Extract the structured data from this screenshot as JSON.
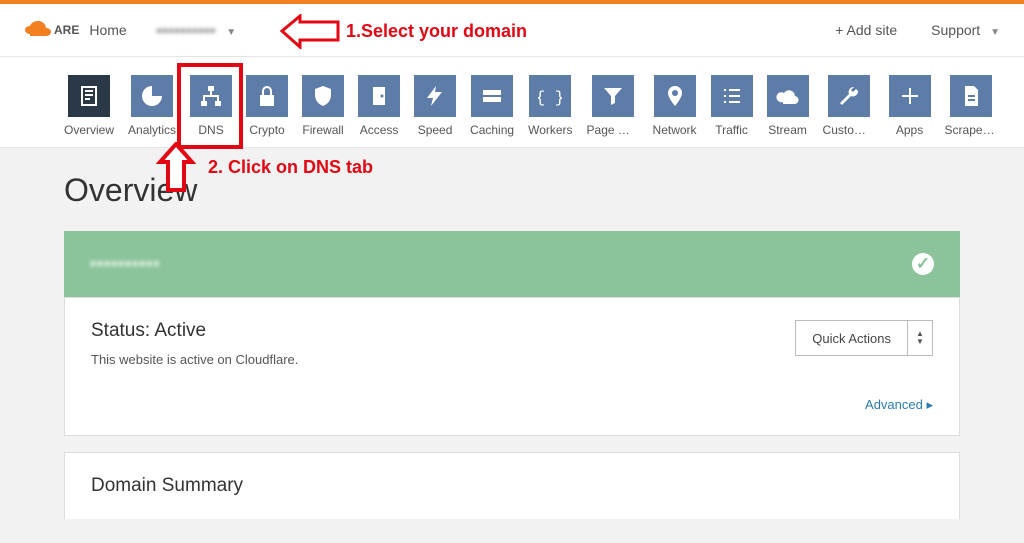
{
  "header": {
    "brand_suffix": "ARE",
    "home": "Home",
    "domain_obscured": "▪▪▪▪▪▪▪▪▪▪",
    "add_site": "+ Add site",
    "support": "Support"
  },
  "tabs": [
    {
      "label": "Overview"
    },
    {
      "label": "Analytics"
    },
    {
      "label": "DNS"
    },
    {
      "label": "Crypto"
    },
    {
      "label": "Firewall"
    },
    {
      "label": "Access"
    },
    {
      "label": "Speed"
    },
    {
      "label": "Caching"
    },
    {
      "label": "Workers"
    },
    {
      "label": "Page Rules"
    },
    {
      "label": "Network"
    },
    {
      "label": "Traffic"
    },
    {
      "label": "Stream"
    },
    {
      "label": "Custom P..."
    },
    {
      "label": "Apps"
    },
    {
      "label": "Scrape Sh..."
    }
  ],
  "page": {
    "title": "Overview"
  },
  "banner": {
    "domain_blur": "▪▪▪▪▪▪▪▪▪▪"
  },
  "status": {
    "heading": "Status: Active",
    "desc": "This website is active on Cloudflare.",
    "quick_actions": "Quick Actions",
    "advanced": "Advanced ▸"
  },
  "summary": {
    "heading": "Domain Summary"
  },
  "annotations": {
    "a1": "1.Select your domain",
    "a2": "2. Click on DNS tab"
  }
}
